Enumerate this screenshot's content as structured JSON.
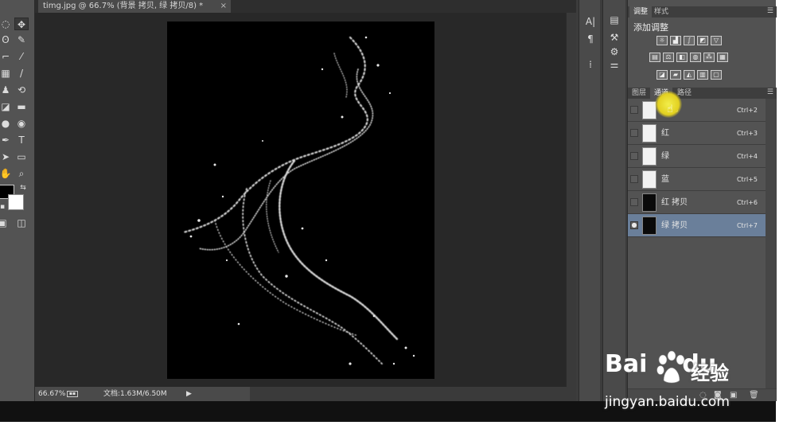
{
  "document": {
    "tab_title": "timg.jpg @ 66.7% (背景 拷贝, 绿 拷贝/8) *",
    "close_glyph": "×"
  },
  "status": {
    "zoom": "66.67%",
    "doc_size": "文档:1.63M/6.50M"
  },
  "panel_top": {
    "tabs": [
      "调整",
      "样式"
    ],
    "title": "添加调整"
  },
  "panel_bottom": {
    "tabs": [
      "图层",
      "通道",
      "路径"
    ]
  },
  "channels": [
    {
      "name": "RGB",
      "shortcut": "Ctrl+2",
      "thumb": "light",
      "visible": false,
      "selected": false
    },
    {
      "name": "红",
      "shortcut": "Ctrl+3",
      "thumb": "light",
      "visible": false,
      "selected": false
    },
    {
      "name": "绿",
      "shortcut": "Ctrl+4",
      "thumb": "light",
      "visible": false,
      "selected": false
    },
    {
      "name": "蓝",
      "shortcut": "Ctrl+5",
      "thumb": "light",
      "visible": false,
      "selected": false
    },
    {
      "name": "红 拷贝",
      "shortcut": "Ctrl+6",
      "thumb": "dark",
      "visible": false,
      "selected": false
    },
    {
      "name": "绿 拷贝",
      "shortcut": "Ctrl+7",
      "thumb": "dark",
      "visible": true,
      "selected": true
    }
  ],
  "watermark": {
    "logo": "Bai",
    "logo_tail": "du",
    "cn": "经验",
    "url": "jingyan.baidu.com"
  },
  "colors": {
    "selected_row": "#6a7f9a",
    "cursor_highlight": "#e2d020"
  }
}
